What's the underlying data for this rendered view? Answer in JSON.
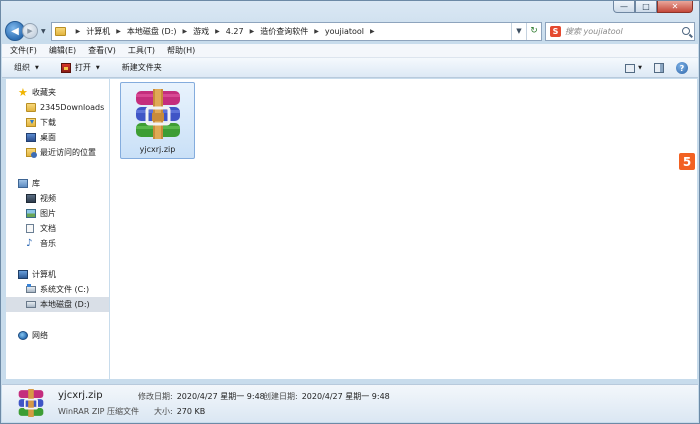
{
  "window": {
    "controls": {
      "minimize": "—",
      "maximize": "□",
      "close": "✕"
    }
  },
  "address_bar": {
    "crumbs": [
      "计算机",
      "本地磁盘 (D:)",
      "游戏",
      "4.27",
      "造价查询软件",
      "youjiatool"
    ]
  },
  "search": {
    "placeholder": "搜索 youjiatool"
  },
  "menubar": {
    "items": [
      "文件(F)",
      "编辑(E)",
      "查看(V)",
      "工具(T)",
      "帮助(H)"
    ]
  },
  "toolbar": {
    "organize": "组织",
    "open": "打开",
    "new_folder": "新建文件夹"
  },
  "nav_pane": {
    "favorites": "收藏夹",
    "favorites_items": [
      "2345Downloads",
      "下载",
      "桌面",
      "最近访问的位置"
    ],
    "libraries": "库",
    "library_items": [
      "视频",
      "图片",
      "文档",
      "音乐"
    ],
    "computer": "计算机",
    "computer_items": [
      "系统文件 (C:)",
      "本地磁盘 (D:)"
    ],
    "network": "网络"
  },
  "files": [
    {
      "name": "yjcxrj.zip",
      "icon": "winrar-archive-icon"
    }
  ],
  "side_badge": "5",
  "details": {
    "name": "yjcxrj.zip",
    "type": "WinRAR ZIP 压缩文件",
    "modified_label": "修改日期:",
    "modified_value": "2020/4/27 星期一 9:48",
    "created_label": "创建日期:",
    "created_value": "2020/4/27 星期一 9:48",
    "size_label": "大小:",
    "size_value": "270 KB"
  },
  "colors": {
    "window_frame": "#c8dcec",
    "selection": "#c9e0f7",
    "badge": "#f26122"
  }
}
